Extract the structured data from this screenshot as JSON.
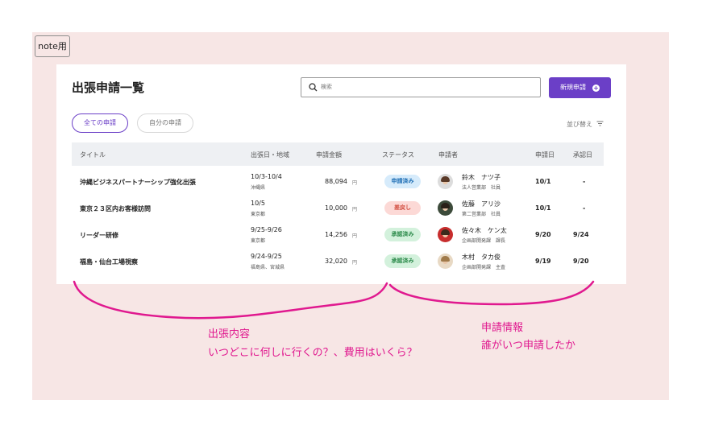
{
  "note_tag": "note用",
  "page_title": "出張申請一覧",
  "search": {
    "placeholder": "検索"
  },
  "new_button": {
    "label": "新規申請",
    "icon": "plus-circle-icon"
  },
  "tabs": [
    {
      "label": "全ての申請",
      "active": true
    },
    {
      "label": "自分の申請",
      "active": false
    }
  ],
  "sort": {
    "label": "並び替え",
    "icon": "filter-lines-icon"
  },
  "columns": [
    "タイトル",
    "出張日・地域",
    "申請金額",
    "ステータス",
    "申請者",
    "申請日",
    "承認日"
  ],
  "rows": [
    {
      "title": "沖縄ビジネスパートナーシップ強化出張",
      "dates": "10/3-10/4",
      "region": "沖縄県",
      "amount": "88,094",
      "unit": "円",
      "status": "申請済み",
      "status_kind": "submitted",
      "name": "鈴木　ナツ子",
      "dept": "法人営業部　社員",
      "applied": "10/1",
      "approved": "-"
    },
    {
      "title": "東京２３区内お客様訪問",
      "dates": "10/5",
      "region": "東京都",
      "amount": "10,000",
      "unit": "円",
      "status": "差戻し",
      "status_kind": "returned",
      "name": "佐藤　アリ沙",
      "dept": "第二営業部　社員",
      "applied": "10/1",
      "approved": "-"
    },
    {
      "title": "リーダー研修",
      "dates": "9/25-9/26",
      "region": "東京都",
      "amount": "14,256",
      "unit": "円",
      "status": "承認済み",
      "status_kind": "approved",
      "name": "佐々木　ケン太",
      "dept": "企画部開発課　課長",
      "applied": "9/20",
      "approved": "9/24"
    },
    {
      "title": "福島・仙台工場視察",
      "dates": "9/24-9/25",
      "region": "福島県、宮城県",
      "amount": "32,020",
      "unit": "円",
      "status": "承認済み",
      "status_kind": "approved",
      "name": "木村　タカ俊",
      "dept": "企画部開発課　主査",
      "applied": "9/19",
      "approved": "9/20"
    }
  ],
  "status_colors": {
    "submitted": {
      "bg": "#d6ebfb",
      "fg": "#1f6fb5"
    },
    "returned": {
      "bg": "#fcd9d6",
      "fg": "#d04a3c"
    },
    "approved": {
      "bg": "#d3f1dc",
      "fg": "#2b8a4a"
    }
  },
  "annotations": {
    "left_title": "出張内容",
    "left_text": "いつどこに何しに行くの？、費用はいくら？",
    "right_title": "申請情報",
    "right_text": "誰がいつ申請したか",
    "color": "#e0198f"
  },
  "accent_color": "#6b3fc7"
}
